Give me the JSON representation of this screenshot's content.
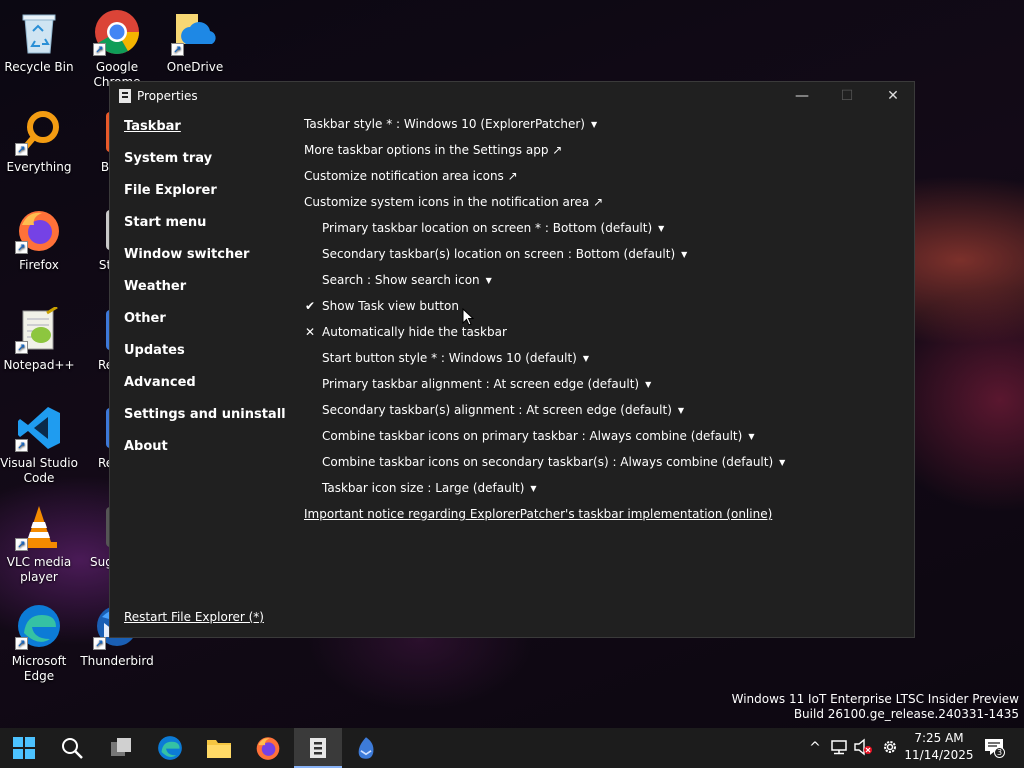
{
  "desktop": {
    "icons": [
      {
        "label": "Recycle Bin",
        "icon": "recycle-bin-icon"
      },
      {
        "label": "Google Chrome",
        "icon": "chrome-icon"
      },
      {
        "label": "OneDrive",
        "icon": "onedrive-icon"
      },
      {
        "label": "Everything",
        "icon": "everything-icon"
      },
      {
        "label": "Firefox",
        "icon": "firefox-icon"
      },
      {
        "label": "Notepad++",
        "icon": "notepadpp-icon"
      },
      {
        "label": "Visual Studio Code",
        "icon": "vscode-icon"
      },
      {
        "label": "VLC media player",
        "icon": "vlc-icon"
      },
      {
        "label": "Microsoft Edge",
        "icon": "edge-icon"
      },
      {
        "label": "Thunderbird",
        "icon": "thunderbird-icon"
      },
      {
        "label": "B",
        "icon": "app-icon"
      },
      {
        "label": "St",
        "icon": "app-icon"
      },
      {
        "label": "Re",
        "icon": "app-icon"
      },
      {
        "label": "Re",
        "icon": "app-icon"
      },
      {
        "label": "Sug",
        "icon": "app-icon"
      }
    ]
  },
  "window": {
    "title": "Properties",
    "controls": {
      "minimize": "—",
      "maximize": "☐",
      "close": "✕"
    },
    "sidebar": {
      "items": [
        "Taskbar",
        "System tray",
        "File Explorer",
        "Start menu",
        "Window switcher",
        "Weather",
        "Other",
        "Updates",
        "Advanced",
        "Settings and uninstall",
        "About"
      ],
      "active": "Taskbar",
      "restart_link": "Restart File Explorer (*)"
    },
    "settings": {
      "rows": [
        {
          "text": "Taskbar style * : Windows 10 (ExplorerPatcher)",
          "suffix": "▼",
          "indent": false
        },
        {
          "text": "More taskbar options in the Settings app",
          "suffix": "↗",
          "indent": false
        },
        {
          "text": "Customize notification area icons",
          "suffix": "↗",
          "indent": false
        },
        {
          "text": "Customize system icons in the notification area",
          "suffix": "↗",
          "indent": false
        },
        {
          "text": "Primary taskbar location on screen * : Bottom (default)",
          "suffix": "▼",
          "indent": true
        },
        {
          "text": "Secondary taskbar(s) location on screen : Bottom (default)",
          "suffix": "▼",
          "indent": true
        },
        {
          "text": "Search : Show search icon",
          "suffix": "▼",
          "indent": true
        },
        {
          "text": "Show Task view button",
          "suffix": "",
          "indent": true,
          "mark": "✔"
        },
        {
          "text": "Automatically hide the taskbar",
          "suffix": "",
          "indent": true,
          "mark": "✕"
        },
        {
          "text": "Start button style * : Windows 10 (default)",
          "suffix": "▼",
          "indent": true
        },
        {
          "text": "Primary taskbar alignment : At screen edge (default)",
          "suffix": "▼",
          "indent": true
        },
        {
          "text": "Secondary taskbar(s) alignment : At screen edge (default)",
          "suffix": "▼",
          "indent": true
        },
        {
          "text": "Combine taskbar icons on primary taskbar : Always combine (default)",
          "suffix": "▼",
          "indent": true
        },
        {
          "text": "Combine taskbar icons on secondary taskbar(s) : Always combine (default)",
          "suffix": "▼",
          "indent": true
        },
        {
          "text": "Taskbar icon size : Large (default)",
          "suffix": "▼",
          "indent": true
        },
        {
          "text": "Important notice regarding ExplorerPatcher's taskbar implementation (online)",
          "suffix": "",
          "indent": false,
          "underline": true
        }
      ]
    }
  },
  "watermark": {
    "line1": "Windows 11 IoT Enterprise LTSC Insider Preview",
    "line2": "Build 26100.ge_release.240331-1435"
  },
  "taskbar": {
    "buttons": [
      "start-icon",
      "search-icon",
      "task-view-icon",
      "edge-icon",
      "file-explorer-icon",
      "firefox-icon",
      "explorerpatcher-icon",
      "thunderbird-icon"
    ],
    "active": "explorerpatcher-icon",
    "clock": {
      "time": "7:25 AM",
      "date": "11/14/2025"
    },
    "notification_count": "3"
  }
}
